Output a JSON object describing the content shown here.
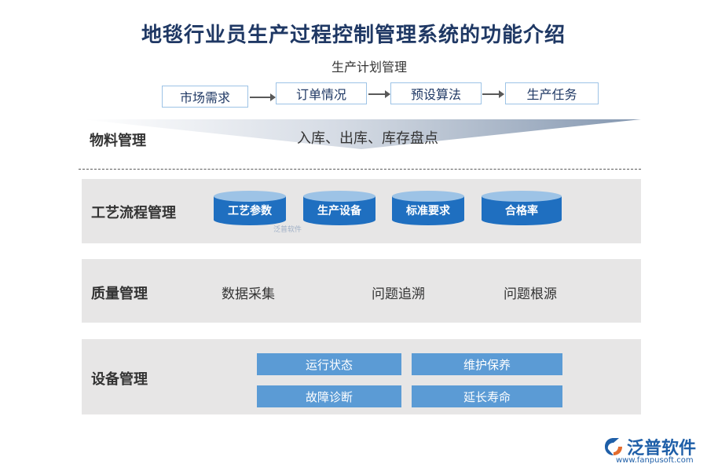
{
  "title": "地毯行业员生产过程控制管理系统的功能介绍",
  "production_plan": {
    "title": "生产计划管理",
    "steps": [
      "市场需求",
      "订单情况",
      "预设算法",
      "生产任务"
    ]
  },
  "material": {
    "label": "物料管理",
    "text": "入库、出库、库存盘点"
  },
  "process": {
    "label": "工艺流程管理",
    "items": [
      "工艺参数",
      "生产设备",
      "标准要求",
      "合格率"
    ]
  },
  "quality": {
    "label": "质量管理",
    "items": [
      "数据采集",
      "问题追溯",
      "问题根源"
    ]
  },
  "equipment": {
    "label": "设备管理",
    "items": [
      "运行状态",
      "维护保养",
      "故障诊断",
      "延长寿命"
    ]
  },
  "brand": {
    "name": "泛普软件",
    "url": "www.fanpusoft.com",
    "watermark": "泛普软件"
  },
  "colors": {
    "title": "#1f3864",
    "cylinder": "#1f6fc0",
    "device_box": "#5b9bd5",
    "band": "#e7e6e6"
  }
}
